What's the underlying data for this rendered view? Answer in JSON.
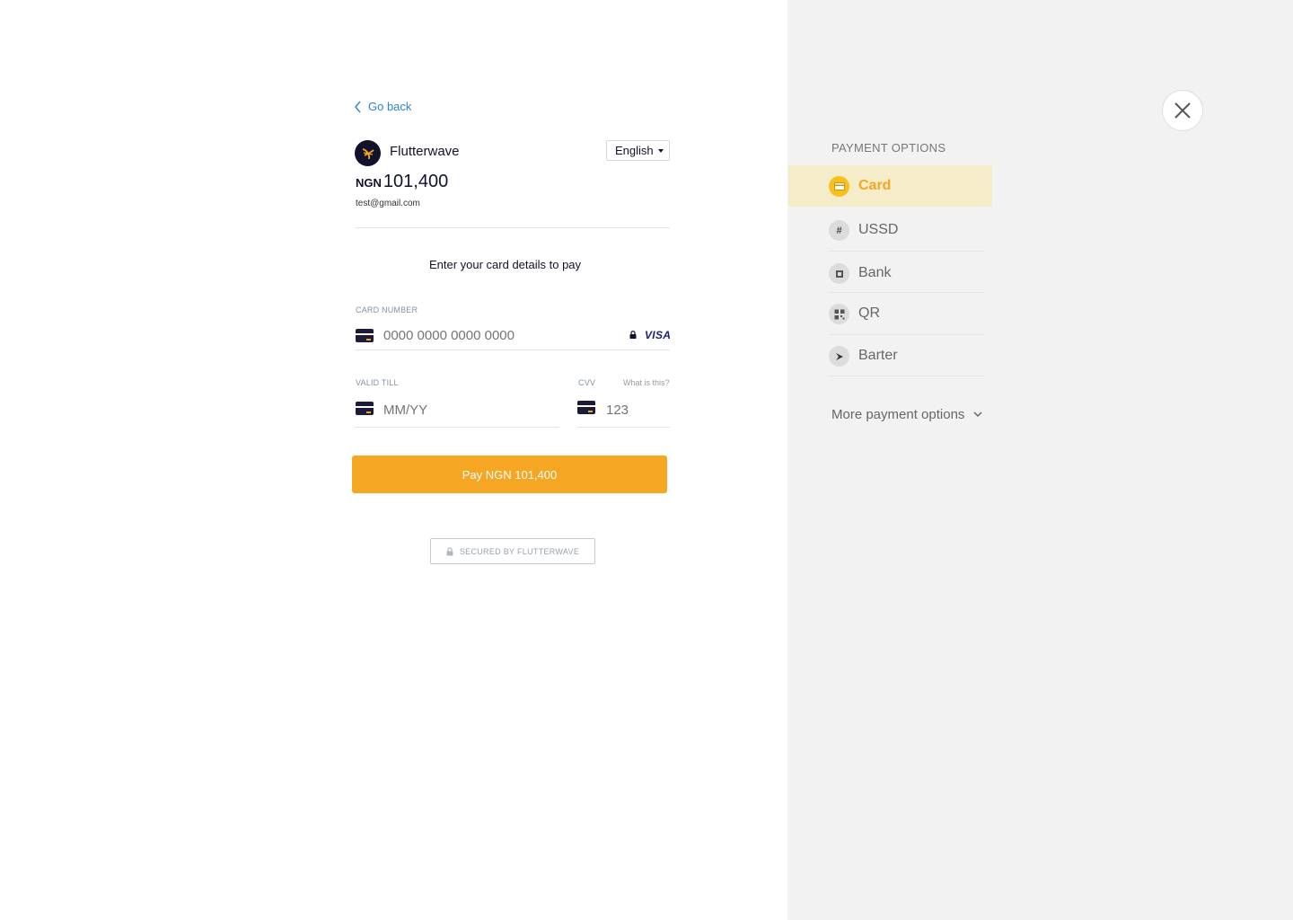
{
  "nav": {
    "go_back_label": "Go back"
  },
  "merchant": {
    "name": "Flutterwave",
    "currency": "NGN",
    "amount": "101,400",
    "email": "test@gmail.com"
  },
  "language": {
    "selected": "English"
  },
  "form": {
    "instruction": "Enter your card details to pay",
    "card_number_label": "CARD NUMBER",
    "card_number_placeholder": "0000 0000 0000 0000",
    "card_brand": "VISA",
    "valid_till_label": "VALID TILL",
    "valid_till_placeholder": "MM/YY",
    "cvv_label": "CVV",
    "cvv_help": "What is this?",
    "cvv_placeholder": "123",
    "pay_button": "Pay NGN 101,400",
    "secured_label": "SECURED BY FLUTTERWAVE"
  },
  "payment_options": {
    "title": "PAYMENT OPTIONS",
    "items": [
      {
        "label": "Card",
        "icon": "card-icon",
        "active": true
      },
      {
        "label": "USSD",
        "icon": "hash-icon",
        "active": false
      },
      {
        "label": "Bank",
        "icon": "bank-icon",
        "active": false
      },
      {
        "label": "QR",
        "icon": "qr-icon",
        "active": false
      },
      {
        "label": "Barter",
        "icon": "barter-icon",
        "active": false
      }
    ],
    "more_label": "More payment options"
  },
  "colors": {
    "accent": "#f5a623",
    "link": "#2d87c8",
    "active_bg": "#f5ecc9",
    "sidebar_bg": "#f2f2f2"
  }
}
